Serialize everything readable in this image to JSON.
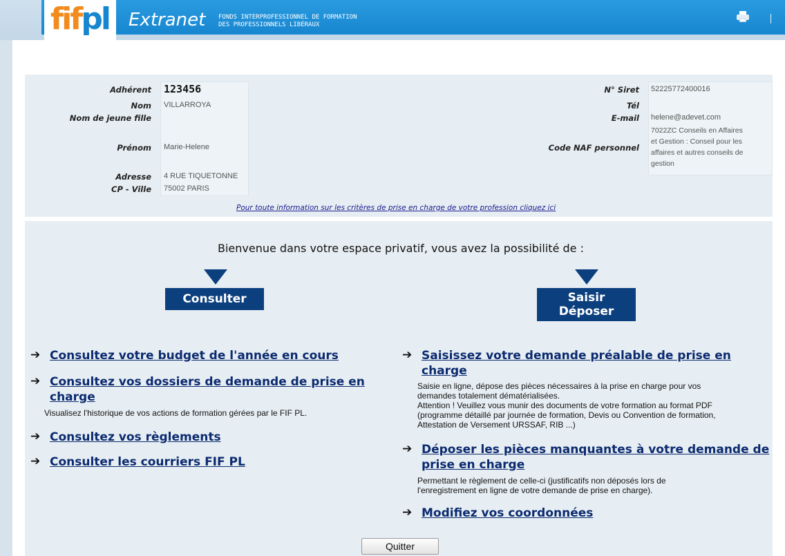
{
  "header": {
    "logo_fi": "fif",
    "logo_pl": "pl",
    "title": "Extranet",
    "subtitle_line1": "FONDS INTERPROFESSIONNEL DE FORMATION",
    "subtitle_line2": "DES PROFESSIONNELS LIBÉRAUX",
    "print_icon": "printer-icon"
  },
  "member": {
    "adherent_label": "Adhérent",
    "adherent_value": "123456",
    "nom_label": "Nom",
    "nom_value": "VILLARROYA",
    "jeune_fille_label": "Nom de jeune fille",
    "prenom_label": "Prénom",
    "prenom_value": "Marie-Helene",
    "adresse_label": "Adresse",
    "adresse_value": "4 RUE TIQUETONNE",
    "cp_label": "CP - Ville",
    "cp_value": "75002 PARIS",
    "siret_label": "N° Siret",
    "siret_value": "52225772400016",
    "tel_label": "Tél",
    "email_label": "E-mail",
    "email_value": "helene@adevet.com",
    "naf_label": "Code NAF personnel",
    "naf_line1": "7022ZC Conseils en Affaires",
    "naf_line2": "et Gestion : Conseil pour les",
    "naf_line3": "affaires et autres conseils de",
    "naf_line4": "gestion",
    "info_link": "Pour toute information sur les critères de prise en charge de votre profession cliquez ici"
  },
  "main": {
    "welcome": "Bienvenue dans votre espace privatif, vous avez la possibilité de :",
    "consulter": "Consulter",
    "saisir": "Saisir",
    "deposer": "Déposer",
    "arrow": "➔",
    "left": {
      "budget": "Consultez votre budget de l'année en cours",
      "dossiers_line1": "Consultez vos dossiers de demande de prise en",
      "dossiers_line2": "charge",
      "dossiers_desc": "Visualisez l'historique de vos actions de formation gérées par le FIF PL.",
      "reglements": "Consultez vos règlements",
      "courriers": "Consulter les courriers FIF PL"
    },
    "right": {
      "saisissez_line1": "Saisissez votre demande préalable de prise en",
      "saisissez_line2": "charge",
      "saisissez_desc1": "Saisie en ligne, dépose des pièces nécessaires à la prise en charge pour vos",
      "saisissez_desc2": "demandes totalement dématérialisées.",
      "saisissez_desc3": "Attention ! Veuillez vous munir des documents de votre formation au format PDF",
      "saisissez_desc4": "(programme détaillé par journée de formation, Devis ou Convention de formation,",
      "saisissez_desc5": "Attestation de Versement URSSAF, RIB ...)",
      "deposer_line1": "Déposer les pièces manquantes à votre demande de",
      "deposer_line2": "prise en charge",
      "deposer_desc1": "Permettant le règlement de celle-ci (justificatifs non déposés lors de",
      "deposer_desc2": "l'enregistrement en ligne de votre demande de prise en charge).",
      "coordonnees": "Modifiez vos coordonnées"
    },
    "quit": "Quitter"
  },
  "colors": {
    "header_blue": "#1786d0",
    "logo_orange": "#f28b1e",
    "navy_box": "#0c3f7e",
    "link_blue": "#0b2a6f"
  }
}
